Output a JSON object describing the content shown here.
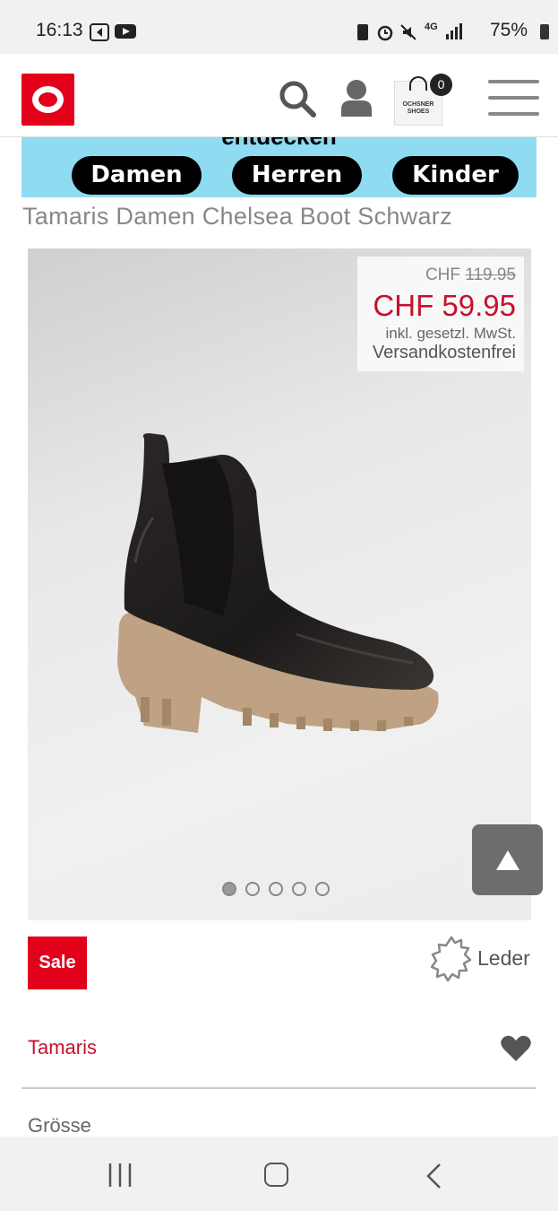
{
  "status_bar": {
    "time": "16:13",
    "network": "4G",
    "battery": "75%"
  },
  "header": {
    "logo_alt": "O",
    "cart": {
      "brand_line1": "OCHSNER",
      "brand_line2": "SHOES",
      "count": "0"
    }
  },
  "banner": {
    "headline": "entdecken",
    "categories": [
      "Damen",
      "Herren",
      "Kinder"
    ],
    "bg_color": "#8fdcf2"
  },
  "product": {
    "title": "Tamaris Damen Chelsea Boot Schwarz",
    "currency": "CHF",
    "old_price": "119.95",
    "new_price": "CHF 59.95",
    "vat_note": "inkl. gesetzl. MwSt.",
    "shipping_note": "Versandkostenfrei",
    "gallery_images": 5,
    "gallery_active_index": 0,
    "sale_badge": "Sale",
    "material": "Leder",
    "brand": "Tamaris",
    "size_label": "Grösse"
  },
  "colors": {
    "brand_red": "#e2001a",
    "price_red": "#c8102e"
  }
}
